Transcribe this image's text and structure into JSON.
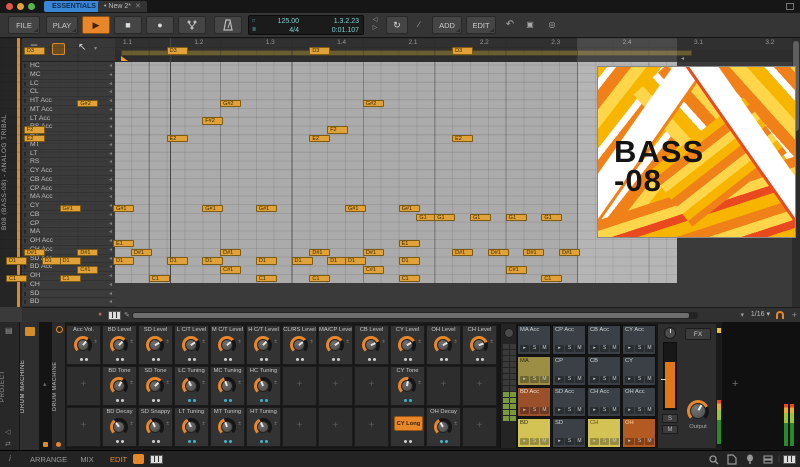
{
  "colors": {
    "accent": "#e8872a",
    "note_fill": "#e2a23a",
    "blue_indicator": "#3fb5cc",
    "workspace_tab_bg": "#3a86d6",
    "track_color": "#d98a2b"
  },
  "titlebar": {
    "workspace_tab": "ESSENTIALS",
    "document_tab": "New 2*",
    "modified_dot": "•",
    "close_glyph": "✕"
  },
  "toolbar": {
    "file_label": "FILE",
    "play_label": "PLAY",
    "add_label": "ADD",
    "edit_label": "EDIT",
    "play_glyph": "▶",
    "stop_glyph": "■",
    "record_glyph": "●",
    "loop_glyph": "↻",
    "slash_glyph": "∕",
    "undo_glyph": "↶",
    "copy_glyph": "▣",
    "pin_glyph": "◎",
    "display": {
      "tempo": "125.00",
      "time_signature": "4/4",
      "position": "1.3.2.23",
      "time": "0:01.107"
    }
  },
  "timeline": {
    "ticks": [
      "1.1",
      "1.2",
      "1.3",
      "1.4",
      "2.1",
      "2.2",
      "2.3",
      "2.4",
      "3.1",
      "3.2"
    ],
    "loop_end_glyph": "◂"
  },
  "editor": {
    "track_label": "B08 (BASS-08) - ANALOG TRIBAL",
    "snap_value": "1/16",
    "lane_arrow_glyph": "◂",
    "lanes": [
      "HC",
      "MC",
      "LC",
      "CL",
      "HT Acc",
      "MT Acc",
      "LT Acc",
      "RS Acc",
      "HT",
      "MT",
      "LT",
      "RS",
      "CY Acc",
      "CB Acc",
      "CP Acc",
      "MA Acc",
      "CY",
      "CB",
      "CP",
      "MA",
      "OH Acc",
      "CH Acc",
      "SD Acc",
      "BD Acc",
      "OH",
      "CH",
      "SD",
      "BD"
    ],
    "notes": [
      {
        "pitch": "D3",
        "lane": 1,
        "steps": [
          1,
          9,
          17,
          25
        ]
      },
      {
        "pitch": "G#2",
        "lane": 7,
        "steps": [
          4,
          12,
          20
        ]
      },
      {
        "pitch": "F#2",
        "lane": 9,
        "steps": [
          11
        ]
      },
      {
        "pitch": "F2",
        "lane": 10,
        "steps": [
          1,
          18
        ]
      },
      {
        "pitch": "E2",
        "lane": 11,
        "steps": [
          1,
          9,
          17,
          25
        ]
      },
      {
        "pitch": "G#1",
        "lane": 19,
        "steps": [
          3,
          6,
          11,
          14,
          19,
          22
        ]
      },
      {
        "pitch": "G1",
        "lane": 20,
        "steps": [
          23,
          24,
          26,
          28,
          30
        ]
      },
      {
        "pitch": "E1",
        "lane": 23,
        "steps": [
          6,
          22
        ]
      },
      {
        "pitch": "D#1",
        "lane": 24,
        "steps": [
          1,
          4,
          7,
          12,
          17,
          20,
          25,
          27,
          29,
          31
        ]
      },
      {
        "pitch": "D1",
        "lane": 25,
        "steps": [
          0,
          2,
          3,
          6,
          9,
          11,
          14,
          16,
          18,
          19,
          22
        ]
      },
      {
        "pitch": "C#1",
        "lane": 26,
        "steps": [
          4,
          12,
          20,
          28
        ]
      },
      {
        "pitch": "C1",
        "lane": 27,
        "steps": [
          0,
          3,
          8,
          14,
          17,
          22,
          30
        ]
      }
    ]
  },
  "artwork": {
    "line1": "BASS",
    "line2": "-08"
  },
  "device": {
    "left_panel_label": "PROJECT",
    "chain_tab_label": "DRUM MACHINE",
    "device_name": "DRUM MACHINE",
    "knob_rows": [
      [
        {
          "label": "Acc Vol.",
          "type": "knob",
          "angle": 40,
          "ind": "gray"
        },
        {
          "label": "BD Level",
          "type": "knob",
          "angle": 45,
          "ind": "gray"
        },
        {
          "label": "SD Level",
          "type": "knob",
          "angle": 60,
          "ind": "gray"
        },
        {
          "label": "L C/T Level",
          "type": "knob",
          "angle": 55,
          "ind": "gray"
        },
        {
          "label": "M C/T Level",
          "type": "knob",
          "angle": 50,
          "ind": "gray"
        },
        {
          "label": "H C/T Level",
          "type": "knob",
          "angle": 45,
          "ind": "gray"
        },
        {
          "label": "CL/RS Level",
          "type": "knob",
          "angle": 50,
          "ind": "gray"
        },
        {
          "label": "MA/CP Level",
          "type": "knob",
          "angle": 55,
          "ind": "gray"
        },
        {
          "label": "CB Level",
          "type": "knob",
          "angle": 65,
          "ind": "gray"
        },
        {
          "label": "CY Level",
          "type": "knob",
          "angle": 60,
          "ind": "gray"
        },
        {
          "label": "OH Level",
          "type": "knob",
          "angle": 60,
          "ind": "gray"
        },
        {
          "label": "CH Level",
          "type": "knob",
          "angle": 70,
          "ind": "gray"
        }
      ],
      [
        {
          "type": "empty"
        },
        {
          "label": "BD Tone",
          "type": "knob",
          "angle": 30,
          "ind": "gray"
        },
        {
          "label": "SD Tone",
          "type": "knob",
          "angle": 45,
          "ind": "gray"
        },
        {
          "label": "LC Tuning",
          "type": "knob",
          "angle": -25,
          "ind": "blue"
        },
        {
          "label": "MC Tuning",
          "type": "knob",
          "angle": -20,
          "ind": "blue"
        },
        {
          "label": "HC Tuning",
          "type": "knob",
          "angle": -20,
          "ind": "blue"
        },
        {
          "type": "empty"
        },
        {
          "type": "empty"
        },
        {
          "type": "empty"
        },
        {
          "label": "CY Tone",
          "type": "knob",
          "angle": 10,
          "ind": "blue"
        },
        {
          "type": "empty"
        },
        {
          "type": "empty"
        }
      ],
      [
        {
          "type": "empty"
        },
        {
          "label": "BD Decay",
          "type": "knob",
          "angle": -35,
          "ind": "gray"
        },
        {
          "label": "SD Snappy",
          "type": "knob",
          "angle": -25,
          "ind": "gray"
        },
        {
          "label": "LT Tuning",
          "type": "knob",
          "angle": -25,
          "ind": "blue"
        },
        {
          "label": "MT Tuning",
          "type": "knob",
          "angle": -20,
          "ind": "blue"
        },
        {
          "label": "HT Tuning",
          "type": "knob",
          "angle": -25,
          "ind": "blue"
        },
        {
          "type": "empty"
        },
        {
          "type": "empty"
        },
        {
          "type": "empty"
        },
        {
          "label": "CY Long",
          "type": "button",
          "ind": "gray"
        },
        {
          "label": "OH Decay",
          "type": "knob",
          "angle": -30,
          "ind": "blue"
        },
        {
          "type": "empty"
        }
      ]
    ],
    "empty_cell_glyph": "+",
    "pads": [
      [
        {
          "label": "MA Acc",
          "bg": "#3a4045",
          "fg": "#ccd4d4"
        },
        {
          "label": "CP Acc",
          "bg": "#3a4045",
          "fg": "#ccd4d4"
        },
        {
          "label": "CB Acc",
          "bg": "#3a4045",
          "fg": "#ccd4d4"
        },
        {
          "label": "CY Acc",
          "bg": "#3a4045",
          "fg": "#ccd4d4"
        }
      ],
      [
        {
          "label": "MA",
          "bg": "#9c8f45",
          "fg": "#2a250f"
        },
        {
          "label": "CP",
          "bg": "#3a4045",
          "fg": "#ccd4d4"
        },
        {
          "label": "CB",
          "bg": "#3a4045",
          "fg": "#ccd4d4"
        },
        {
          "label": "CY",
          "bg": "#3a4045",
          "fg": "#ccd4d4"
        }
      ],
      [
        {
          "label": "BD Acc",
          "bg": "#99502b",
          "fg": "#ffe6d0"
        },
        {
          "label": "SD Acc",
          "bg": "#3a4045",
          "fg": "#ccd4d4"
        },
        {
          "label": "CH Acc",
          "bg": "#3a4045",
          "fg": "#ccd4d4"
        },
        {
          "label": "OH Acc",
          "bg": "#3a4045",
          "fg": "#ccd4d4"
        }
      ],
      [
        {
          "label": "BD",
          "bg": "#d3c355",
          "fg": "#2e2a10"
        },
        {
          "label": "SD",
          "bg": "#3a4045",
          "fg": "#ccd4d4"
        },
        {
          "label": "CH",
          "bg": "#d3c355",
          "fg": "#6b4a10"
        },
        {
          "label": "OH",
          "bg": "#b25a22",
          "fg": "#ffd9a0"
        }
      ]
    ],
    "pad_buttons": {
      "play": "▸",
      "solo": "S",
      "mute": "M"
    },
    "mixer": {
      "fx_label": "FX",
      "solo_label": "S",
      "mute_label": "M",
      "output_label": "Output"
    }
  },
  "statusbar": {
    "info_glyph": "i",
    "views": [
      {
        "label": "ARRANGE",
        "active": false
      },
      {
        "label": "MIX",
        "active": false
      },
      {
        "label": "EDIT",
        "active": true
      }
    ]
  }
}
